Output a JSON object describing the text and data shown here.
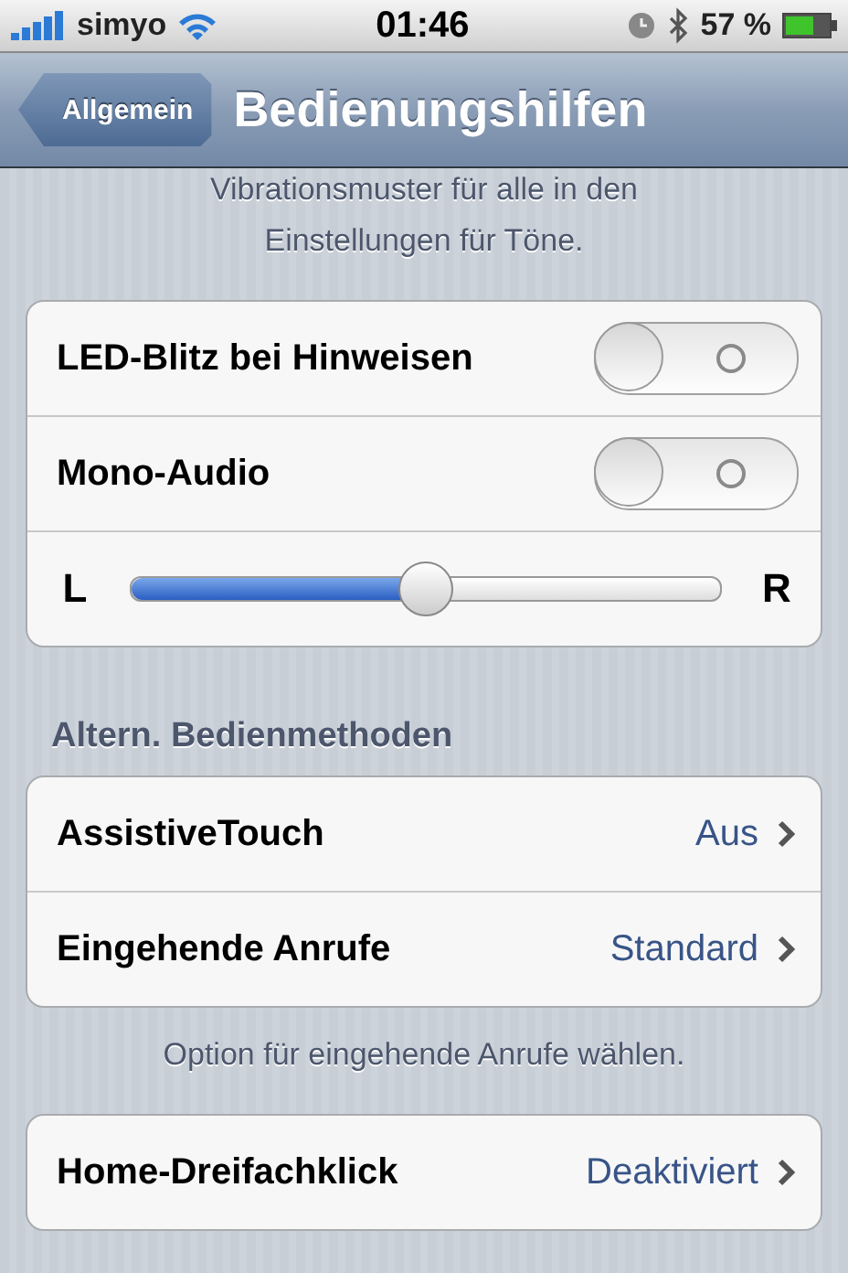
{
  "status_bar": {
    "carrier": "simyo",
    "time": "01:46",
    "battery": "57 %"
  },
  "nav": {
    "back": "Allgemein",
    "title": "Bedienungshilfen"
  },
  "sections": [
    {
      "footer": "Vibrationsmuster für alle in den Einstellungen für Töne."
    },
    {
      "rows": [
        {
          "kind": "toggle",
          "label": "LED-Blitz bei Hinweisen",
          "on": false
        },
        {
          "kind": "toggle",
          "label": "Mono-Audio",
          "on": false
        },
        {
          "kind": "slider",
          "left": "L",
          "right": "R",
          "level": 0.5
        }
      ]
    },
    {
      "header": "Altern. Bedienmethoden",
      "footer": "Option für eingehende Anrufe wählen.",
      "rows": [
        {
          "kind": "disclosure",
          "label": "AssistiveTouch",
          "value": "Aus"
        },
        {
          "kind": "disclosure",
          "label": "Eingehende Anrufe",
          "value": "Standard"
        }
      ]
    },
    {
      "rows": [
        {
          "kind": "disclosure",
          "label": "Home-Dreifachklick",
          "value": "Deaktiviert"
        }
      ]
    }
  ]
}
